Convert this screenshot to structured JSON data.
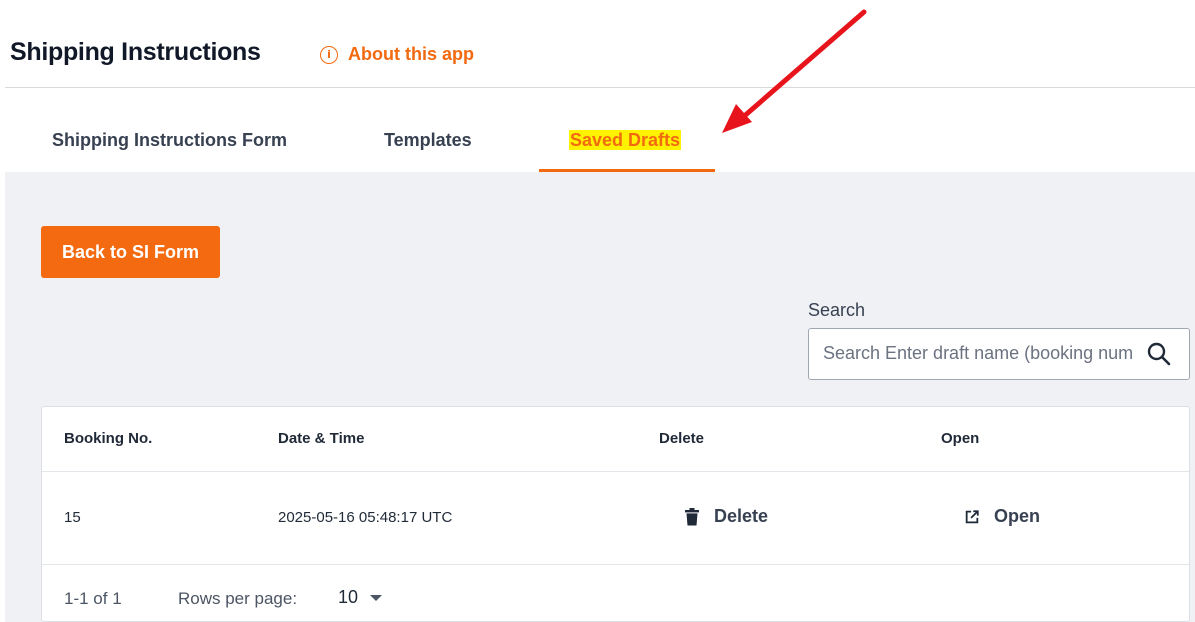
{
  "app": {
    "title": "Shipping Instructions",
    "about_label": "About this app",
    "about_icon": "info-icon"
  },
  "tabs": [
    {
      "label": "Shipping Instructions Form",
      "active": false
    },
    {
      "label": "Templates",
      "active": false
    },
    {
      "label": "Saved Drafts",
      "active": true
    }
  ],
  "actions": {
    "back_label": "Back to SI Form"
  },
  "search": {
    "label": "Search",
    "placeholder": "Search Enter draft name (booking number)",
    "icon": "search-icon"
  },
  "table": {
    "columns": [
      "Booking No.",
      "Date & Time",
      "Delete",
      "Open"
    ],
    "rows": [
      {
        "booking_no": "15",
        "date_time": "2025-05-16 05:48:17 UTC",
        "delete_label": "Delete",
        "open_label": "Open"
      }
    ]
  },
  "pagination": {
    "range": "1-1 of 1",
    "rows_label": "Rows per page:",
    "rows_value": "10"
  },
  "colors": {
    "accent": "#f26a10",
    "highlight": "#fff200",
    "annotation_arrow": "#e8141c",
    "content_bg": "#eff1f4"
  }
}
